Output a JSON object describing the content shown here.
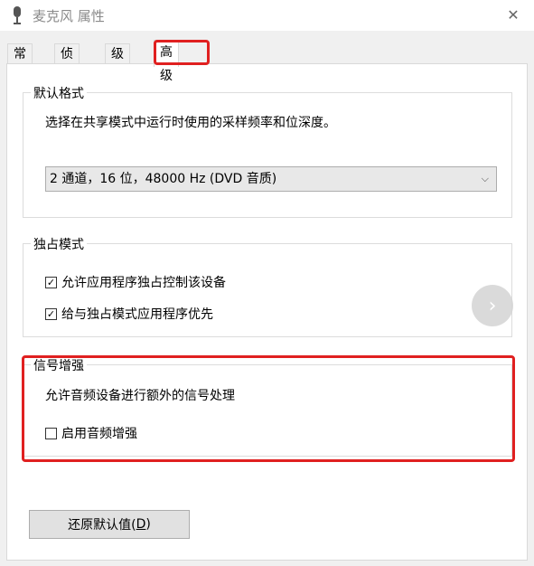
{
  "window": {
    "title": "麦克风 属性",
    "close_glyph": "✕"
  },
  "tabs": [
    {
      "label": "常规"
    },
    {
      "label": "侦听"
    },
    {
      "label": "级别"
    },
    {
      "label": "高级",
      "active": true
    }
  ],
  "default_format": {
    "group_label": "默认格式",
    "description": "选择在共享模式中运行时使用的采样频率和位深度。",
    "selected": "2 通道，16 位，48000 Hz (DVD 音质)"
  },
  "exclusive_mode": {
    "group_label": "独占模式",
    "options": [
      {
        "label": "允许应用程序独占控制该设备",
        "checked": true
      },
      {
        "label": "给与独占模式应用程序优先",
        "checked": true
      }
    ]
  },
  "signal_enhancement": {
    "group_label": "信号增强",
    "description": "允许音频设备进行额外的信号处理",
    "option": {
      "label": "启用音频增强",
      "checked": false
    }
  },
  "restore_button": {
    "label_main": "还原默认值(",
    "label_key": "D",
    "label_end": ")"
  },
  "colors": {
    "highlight": "#e02020",
    "background": "#f0f0f0",
    "panel": "#ffffff"
  }
}
